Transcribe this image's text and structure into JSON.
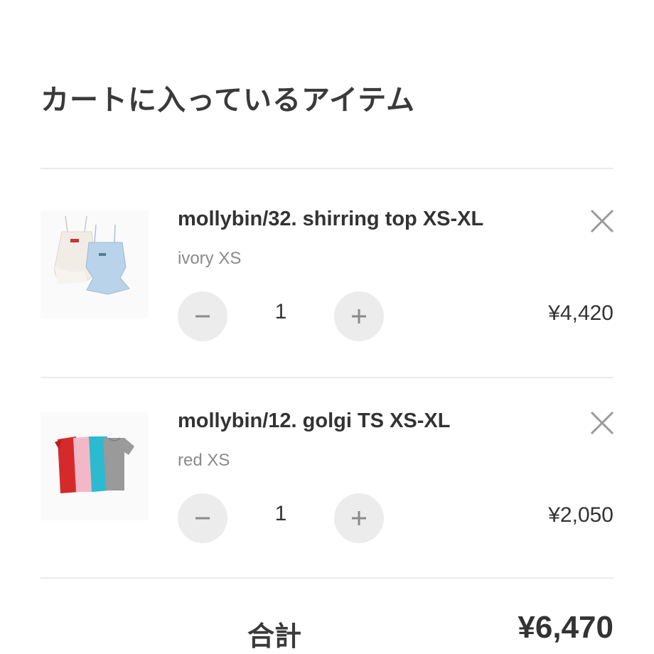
{
  "cart": {
    "title": "カートに入っているアイテム",
    "items": [
      {
        "name": "mollybin/32. shirring top XS-XL",
        "variant": "ivory XS",
        "quantity": "1",
        "price": "¥4,420"
      },
      {
        "name": "mollybin/12. golgi TS XS-XL",
        "variant": "red XS",
        "quantity": "1",
        "price": "¥2,050"
      }
    ],
    "total_label": "合計",
    "total_value": "¥6,470"
  },
  "icons": {
    "remove": "close-icon",
    "decrease": "minus-icon",
    "increase": "plus-icon"
  },
  "colors": {
    "text": "#333333",
    "muted": "#8a8a8a",
    "button_bg": "#ececec",
    "divider": "#eaeaea"
  }
}
